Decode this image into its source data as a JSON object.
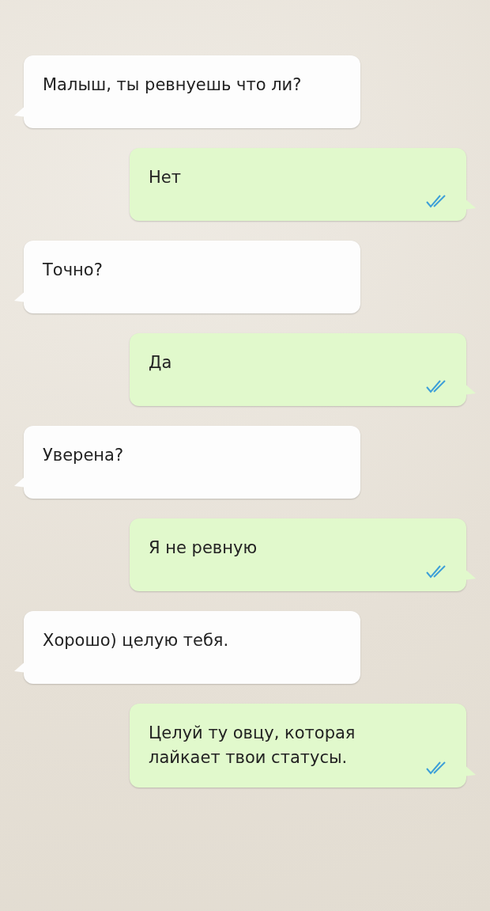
{
  "messages": [
    {
      "kind": "incoming",
      "text": "Малыш, ты ревнуешь что ли?"
    },
    {
      "kind": "outgoing",
      "text": "Нет",
      "read": true
    },
    {
      "kind": "incoming",
      "text": "Точно?"
    },
    {
      "kind": "outgoing",
      "text": "Да",
      "read": true
    },
    {
      "kind": "incoming",
      "text": "Уверена?"
    },
    {
      "kind": "outgoing",
      "text": "Я не ревную",
      "read": true
    },
    {
      "kind": "incoming",
      "text": "Хорошо) целую тебя."
    },
    {
      "kind": "outgoing",
      "text": "Целуй ту овцу, которая лайкает твои статусы.",
      "read": true
    }
  ]
}
